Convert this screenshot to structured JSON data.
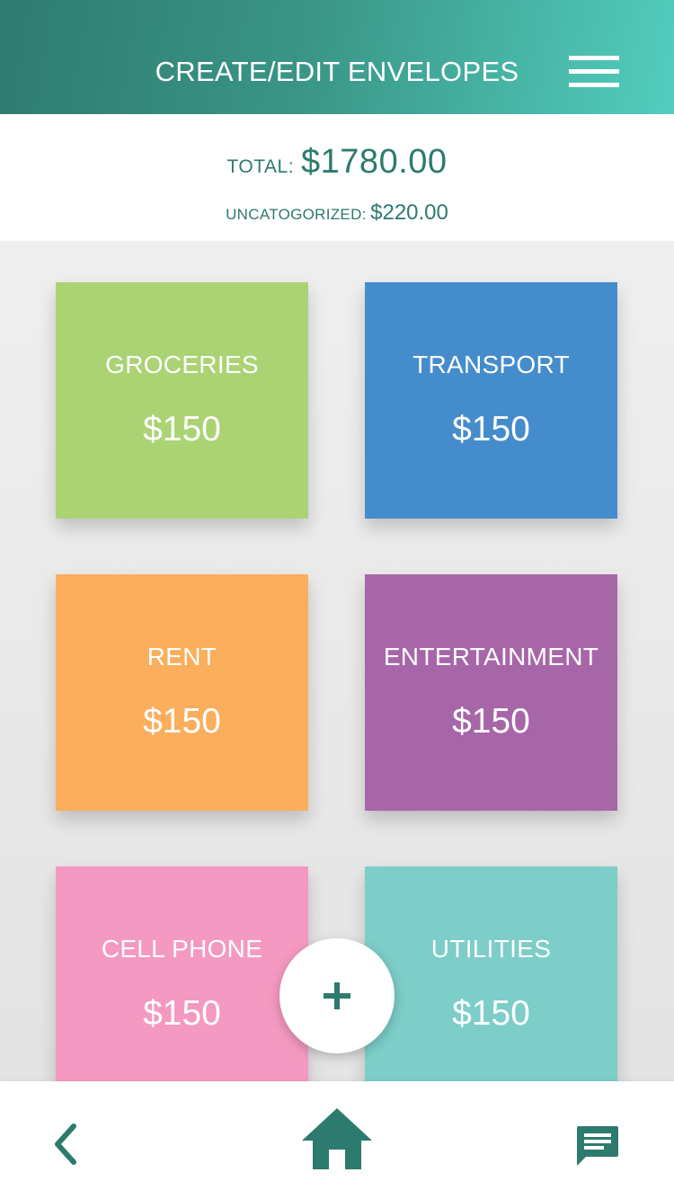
{
  "header": {
    "title": "CREATE/EDIT ENVELOPES",
    "menu_icon": "hamburger-menu-icon"
  },
  "totals": {
    "total_label": "TOTAL:",
    "total_value": "$1780.00",
    "uncategorized_label": "UNCATOGORIZED:",
    "uncategorized_value": "$220.00"
  },
  "envelopes": [
    {
      "name": "GROCERIES",
      "amount": "$150",
      "color": "#abd374"
    },
    {
      "name": "TRANSPORT",
      "amount": "$150",
      "color": "#458ccc"
    },
    {
      "name": "RENT",
      "amount": "$150",
      "color": "#fbae5b"
    },
    {
      "name": "ENTERTAINMENT",
      "amount": "$150",
      "color": "#a766a8"
    },
    {
      "name": "CELL PHONE",
      "amount": "$150",
      "color": "#f499c1"
    },
    {
      "name": "UTILITIES",
      "amount": "$150",
      "color": "#7dcdc8"
    }
  ],
  "fab": {
    "icon": "plus-icon"
  },
  "bottom_nav": {
    "back_icon": "chevron-left-icon",
    "home_icon": "home-icon",
    "chat_icon": "chat-icon"
  },
  "colors": {
    "accent": "#2d7a6e",
    "header_gradient_start": "#2e7b6f",
    "header_gradient_end": "#52cdbe"
  }
}
